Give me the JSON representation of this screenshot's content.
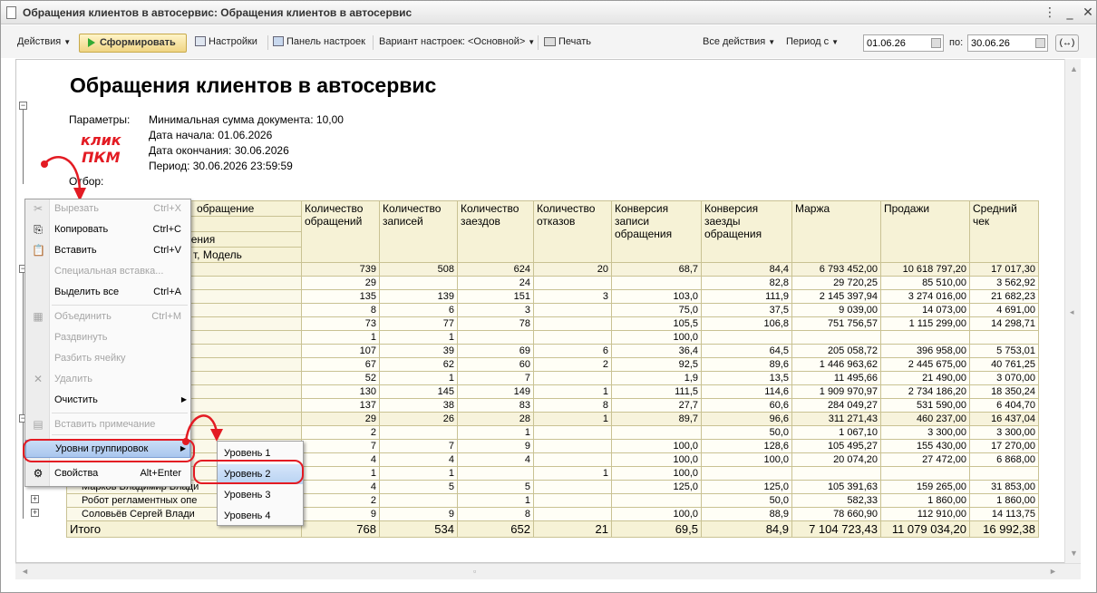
{
  "window": {
    "title": "Обращения клиентов в автосервис: Обращения клиентов в автосервис"
  },
  "toolbar": {
    "actions": "Действия",
    "generate": "Сформировать",
    "settings": "Настройки",
    "settings_panel": "Панель настроек",
    "variant": "Вариант настроек: <Основной>",
    "print": "Печать",
    "all_actions": "Все действия",
    "period_from": "Период с",
    "date_from": "01.06.26",
    "to_label": "по:",
    "date_to": "30.06.26",
    "refresh": "(↔)"
  },
  "report": {
    "title": "Обращения клиентов в автосервис",
    "params_label": "Параметры:",
    "params": [
      "Минимальная сумма документа: 10,00",
      "Дата начала: 01.06.2026",
      "Дата окончания: 30.06.2026",
      "Период: 30.06.2026 23:59:59"
    ],
    "filter_label": "Отбор:",
    "headers": {
      "c0a": "обращение",
      "c0b": "щения",
      "c0c": "т, Модель",
      "c1": "Количество обращений",
      "c2": "Количество записей",
      "c3": "Количество заездов",
      "c4": "Количество отказов",
      "c5": "Конверсия записи обращения",
      "c6": "Конверсия заезды обращения",
      "c7": "Маржа",
      "c8": "Продажи",
      "c9": "Средний чек"
    },
    "rows": [
      [
        "",
        "739",
        "508",
        "624",
        "20",
        "68,7",
        "84,4",
        "6 793 452,00",
        "10 618 797,20",
        "17 017,30"
      ],
      [
        "",
        "29",
        "",
        "24",
        "",
        "",
        "82,8",
        "29 720,25",
        "85 510,00",
        "3 562,92"
      ],
      [
        "ирович",
        "135",
        "139",
        "151",
        "3",
        "103,0",
        "111,9",
        "2 145 397,94",
        "3 274 016,00",
        "21 682,23"
      ],
      [
        "ич",
        "8",
        "6",
        "3",
        "",
        "75,0",
        "37,5",
        "9 039,00",
        "14 073,00",
        "4 691,00"
      ],
      [
        "вич",
        "73",
        "77",
        "78",
        "",
        "105,5",
        "106,8",
        "751 756,57",
        "1 115 299,00",
        "14 298,71"
      ],
      [
        "ович",
        "1",
        "1",
        "",
        "",
        "100,0",
        "",
        "",
        "",
        ""
      ],
      [
        "ич",
        "107",
        "39",
        "69",
        "6",
        "36,4",
        "64,5",
        "205 058,72",
        "396 958,00",
        "5 753,01"
      ],
      [
        "мирович",
        "67",
        "62",
        "60",
        "2",
        "92,5",
        "89,6",
        "1 446 963,62",
        "2 445 675,00",
        "40 761,25"
      ],
      [
        "вич",
        "52",
        "1",
        "7",
        "",
        "1,9",
        "13,5",
        "11 495,66",
        "21 490,00",
        "3 070,00"
      ],
      [
        "мирович",
        "130",
        "145",
        "149",
        "1",
        "111,5",
        "114,6",
        "1 909 970,97",
        "2 734 186,20",
        "18 350,24"
      ],
      [
        "вич",
        "137",
        "38",
        "83",
        "8",
        "27,7",
        "60,6",
        "284 049,27",
        "531 590,00",
        "6 404,70"
      ],
      [
        "",
        "29",
        "26",
        "28",
        "1",
        "89,7",
        "96,6",
        "311 271,43",
        "460 237,00",
        "16 437,04"
      ],
      [
        "",
        "2",
        "",
        "1",
        "",
        "",
        "50,0",
        "1 067,10",
        "3 300,00",
        "3 300,00"
      ],
      [
        "",
        "7",
        "7",
        "9",
        "",
        "100,0",
        "128,6",
        "105 495,27",
        "155 430,00",
        "17 270,00"
      ],
      [
        "",
        "4",
        "4",
        "4",
        "",
        "100,0",
        "100,0",
        "20 074,20",
        "27 472,00",
        "6 868,00"
      ],
      [
        "",
        "1",
        "1",
        "",
        "1",
        "100,0",
        "",
        "",
        "",
        ""
      ],
      [
        "Марков Владимир Влади",
        "4",
        "5",
        "5",
        "",
        "125,0",
        "125,0",
        "105 391,63",
        "159 265,00",
        "31 853,00"
      ],
      [
        "Робот регламентных опе",
        "2",
        "",
        "1",
        "",
        "",
        "50,0",
        "582,33",
        "1 860,00",
        "1 860,00"
      ],
      [
        "Соловьёв Сергей Влади",
        "9",
        "9",
        "8",
        "",
        "100,0",
        "88,9",
        "78 660,90",
        "112 910,00",
        "14 113,75"
      ]
    ],
    "total": [
      "Итого",
      "768",
      "534",
      "652",
      "21",
      "69,5",
      "84,9",
      "7 104 723,43",
      "11 079 034,20",
      "16 992,38"
    ]
  },
  "context_menu": {
    "items": [
      {
        "label": "Вырезать",
        "shortcut": "Ctrl+X"
      },
      {
        "label": "Копировать",
        "shortcut": "Ctrl+C"
      },
      {
        "label": "Вставить",
        "shortcut": "Ctrl+V"
      },
      {
        "label": "Специальная вставка...",
        "shortcut": ""
      },
      {
        "label": "Выделить все",
        "shortcut": "Ctrl+A"
      },
      {
        "label": "Объединить",
        "shortcut": "Ctrl+M"
      },
      {
        "label": "Раздвинуть",
        "shortcut": ""
      },
      {
        "label": "Разбить ячейку",
        "shortcut": ""
      },
      {
        "label": "Удалить",
        "shortcut": ""
      },
      {
        "label": "Очистить",
        "shortcut": ""
      },
      {
        "label": "Вставить примечание",
        "shortcut": ""
      },
      {
        "label": "Уровни группировок",
        "shortcut": ""
      },
      {
        "label": "Свойства",
        "shortcut": "Alt+Enter"
      }
    ]
  },
  "submenu": {
    "items": [
      "Уровень 1",
      "Уровень 2",
      "Уровень 3",
      "Уровень 4"
    ]
  },
  "annotation": {
    "line1": "клик",
    "line2": "ПКМ"
  },
  "colors": {
    "highlight": "#e31b23",
    "menu_highlight": "#b8d2f2",
    "table_header": "#f6f2d6"
  }
}
